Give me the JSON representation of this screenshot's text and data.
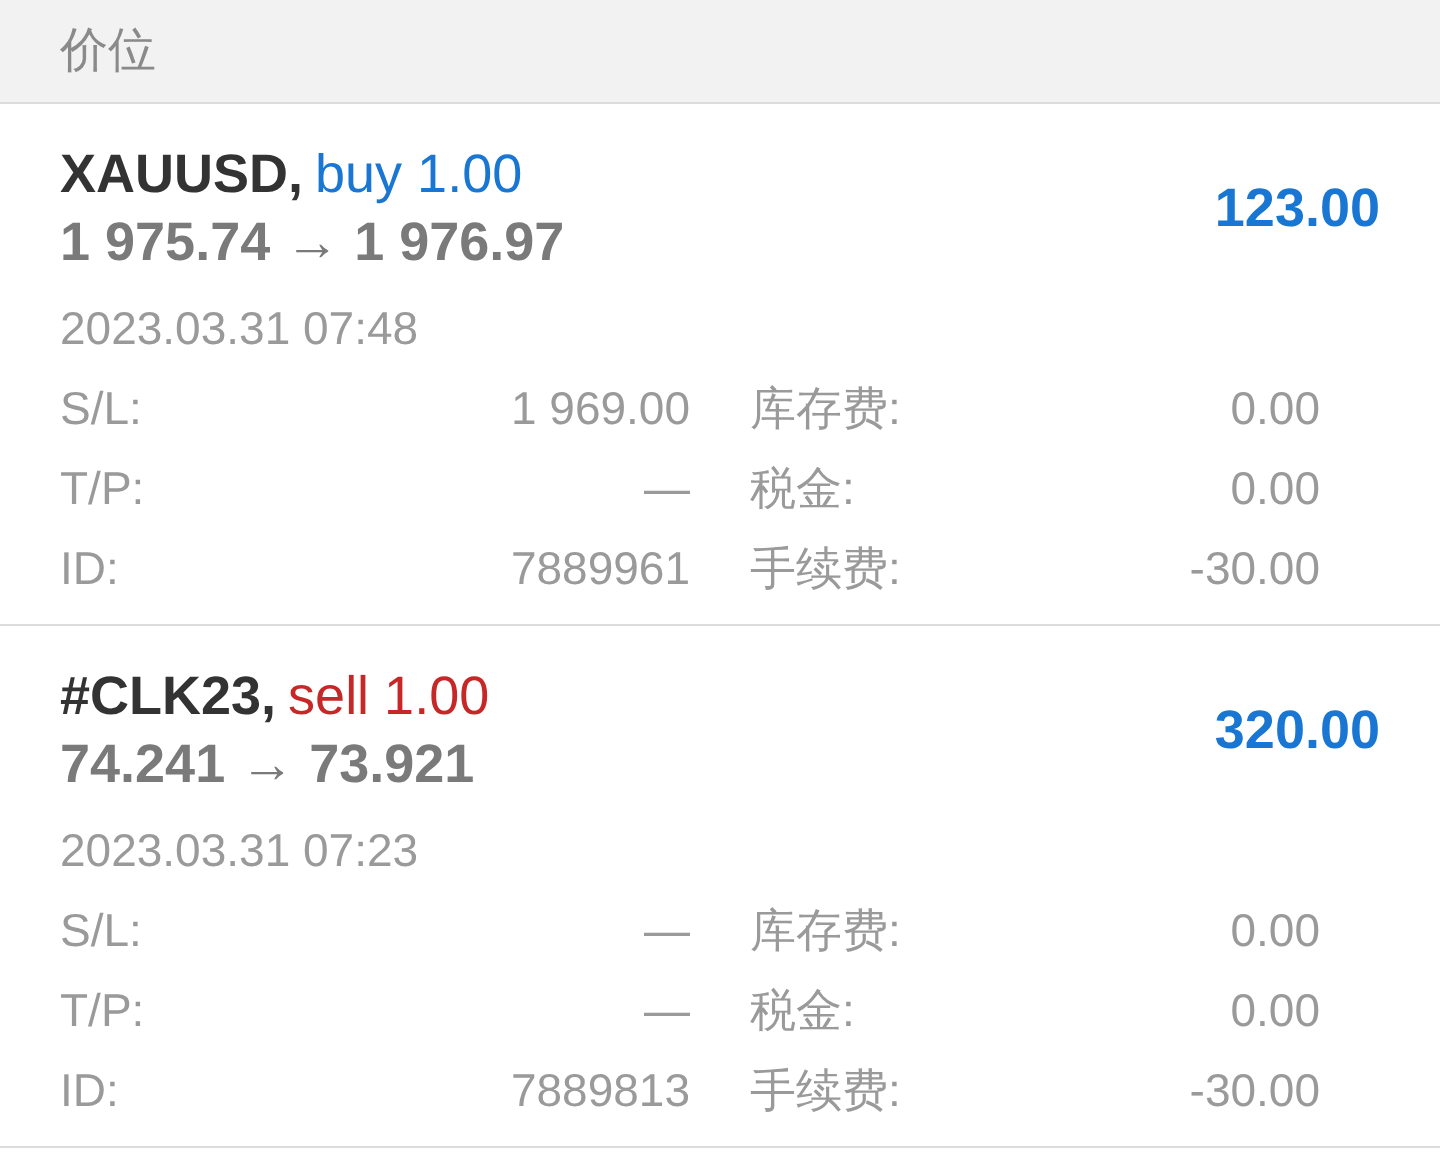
{
  "header": {
    "title": "价位"
  },
  "positions": [
    {
      "symbol": "XAUUSD,",
      "kind": "buy",
      "order": "buy 1.00",
      "prices": "1 975.74 → 1 976.97",
      "profit": "123.00",
      "time": "2023.03.31 07:48",
      "fields": [
        {
          "label": "S/L:",
          "value": "1 969.00"
        },
        {
          "label": "库存费:",
          "value": "0.00"
        },
        {
          "label": "T/P:",
          "value": "—"
        },
        {
          "label": "税金:",
          "value": "0.00"
        },
        {
          "label": "ID:",
          "value": "7889961"
        },
        {
          "label": "手续费:",
          "value": "-30.00"
        }
      ]
    },
    {
      "symbol": "#CLK23,",
      "kind": "sell",
      "order": "sell 1.00",
      "prices": "74.241 → 73.921",
      "profit": "320.00",
      "time": "2023.03.31 07:23",
      "fields": [
        {
          "label": "S/L:",
          "value": "—"
        },
        {
          "label": "库存费:",
          "value": "0.00"
        },
        {
          "label": "T/P:",
          "value": "—"
        },
        {
          "label": "税金:",
          "value": "0.00"
        },
        {
          "label": "ID:",
          "value": "7889813"
        },
        {
          "label": "手续费:",
          "value": "-30.00"
        }
      ]
    }
  ]
}
